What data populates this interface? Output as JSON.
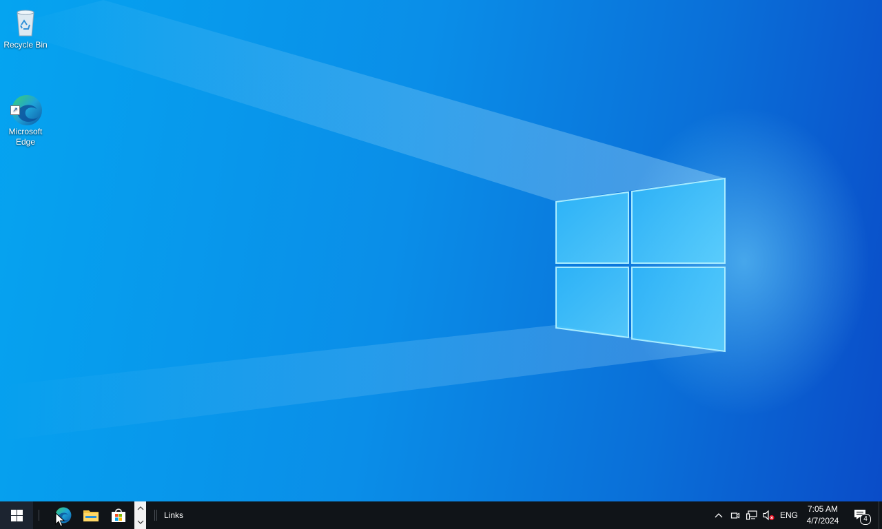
{
  "desktop": {
    "icons": [
      {
        "label": "Recycle Bin",
        "icon": "recycle-bin-icon"
      },
      {
        "label": "Microsoft\nEdge",
        "icon": "edge-icon"
      }
    ]
  },
  "taskbar": {
    "start": {
      "icon": "windows-logo-icon"
    },
    "pinned": [
      {
        "name": "Microsoft Edge",
        "icon": "edge-icon"
      },
      {
        "name": "File Explorer",
        "icon": "folder-icon"
      },
      {
        "name": "Microsoft Store",
        "icon": "store-icon"
      }
    ],
    "toolbar_label": "Links",
    "tray": {
      "language": "ENG",
      "time": "7:05 AM",
      "date": "4/7/2024",
      "notification_count": "4"
    }
  },
  "colors": {
    "taskbar_bg": "#101418",
    "desktop_blue": "#0a8ee8"
  }
}
